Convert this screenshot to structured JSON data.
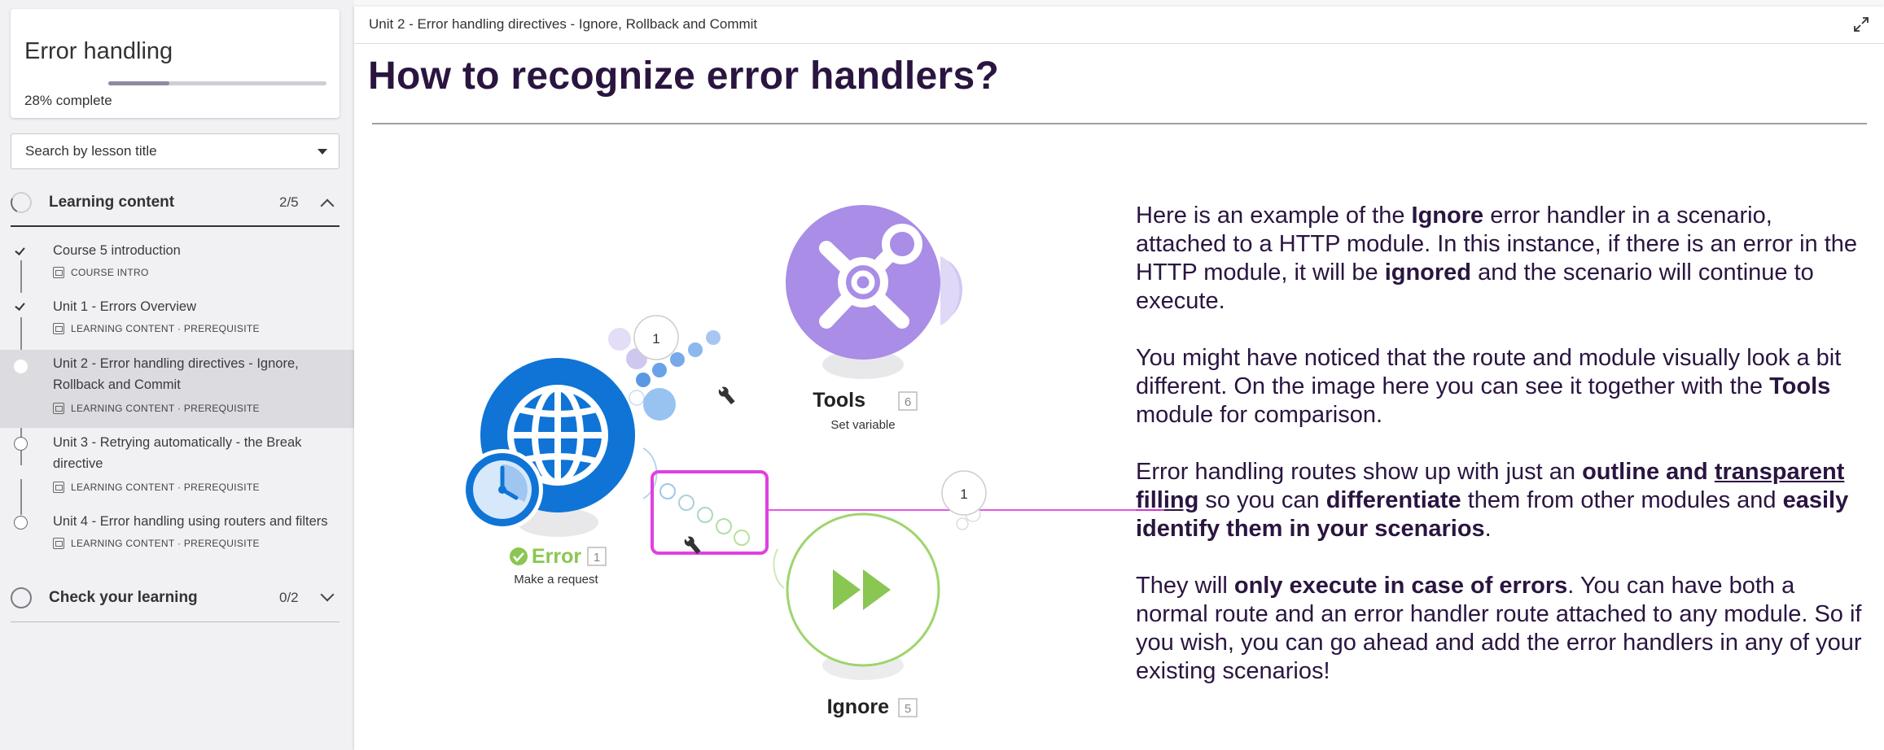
{
  "sidebar": {
    "course_title": "Error handling",
    "progress_percent": "28%",
    "progress_suffix": " complete",
    "progress_fraction": 0.28,
    "search_placeholder": "Search by lesson title",
    "sections": [
      {
        "label": "Learning content",
        "count": "2/5",
        "expanded": true
      },
      {
        "label": "Check your learning",
        "count": "0/2",
        "expanded": false
      }
    ],
    "lessons": [
      {
        "title_lines": [
          "Course 5 introduction"
        ],
        "meta": "COURSE INTRO",
        "status": "done"
      },
      {
        "title_lines": [
          "Unit 1 - Errors Overview"
        ],
        "meta": "LEARNING CONTENT · PREREQUISITE",
        "status": "done"
      },
      {
        "title_lines": [
          "Unit 2 - Error handling directives - Ignore,",
          "Rollback and Commit"
        ],
        "meta": "LEARNING CONTENT · PREREQUISITE",
        "status": "current"
      },
      {
        "title_lines": [
          "Unit 3 - Retrying automatically - the Break",
          "directive"
        ],
        "meta": "LEARNING CONTENT · PREREQUISITE",
        "status": "todo"
      },
      {
        "title_lines": [
          "Unit 4 - Error handling using routers and filters"
        ],
        "meta": "LEARNING CONTENT · PREREQUISITE",
        "status": "todo"
      }
    ]
  },
  "main": {
    "breadcrumb": "Unit 2 - Error handling directives - Ignore, Rollback and Commit",
    "title": "How to recognize error handlers?",
    "paragraphs": [
      [
        {
          "t": "Here is an example of the "
        },
        {
          "t": "Ignore",
          "b": true
        },
        {
          "t": " error handler in a scenario, attached to a HTTP module. In this instance, if there is an error in the HTTP module, it will be "
        },
        {
          "t": "ignored",
          "b": true
        },
        {
          "t": " and the scenario will continue to execute."
        }
      ],
      [
        {
          "t": "You might have noticed that the route and module visually look a bit different. On the image here you can see it together with the "
        },
        {
          "t": "Tools",
          "b": true
        },
        {
          "t": " module for comparison."
        }
      ],
      [
        {
          "t": "Error handling routes show up with just an "
        },
        {
          "t": "outline and",
          "b": true
        },
        {
          "t": " "
        },
        {
          "t": "transparent filling",
          "b": true,
          "u": true
        },
        {
          "t": " so you can "
        },
        {
          "t": "differentiate",
          "b": true
        },
        {
          "t": " them from other modules and "
        },
        {
          "t": "easily identify them in your scenarios",
          "b": true
        },
        {
          "t": "."
        }
      ],
      [
        {
          "t": "They will "
        },
        {
          "t": "only execute in case of errors",
          "b": true
        },
        {
          "t": ". You can have both a normal route and an error handler route attached to any module. So if you wish, you can go ahead and add the error handlers in any of your existing scenarios!"
        }
      ]
    ]
  },
  "diagram": {
    "tools": {
      "name": "Tools",
      "id": "6",
      "subtitle": "Set variable"
    },
    "http": {
      "name": "Error",
      "id": "1",
      "subtitle": "Make a request"
    },
    "ignore": {
      "name": "Ignore",
      "id": "5"
    },
    "route_counts": [
      "1",
      "1"
    ],
    "colors": {
      "tools": "#a98de6",
      "http": "#0f74d6",
      "ignore_outline": "#9fd46d",
      "highlight": "#e040e0",
      "title": "#2a1540"
    }
  }
}
